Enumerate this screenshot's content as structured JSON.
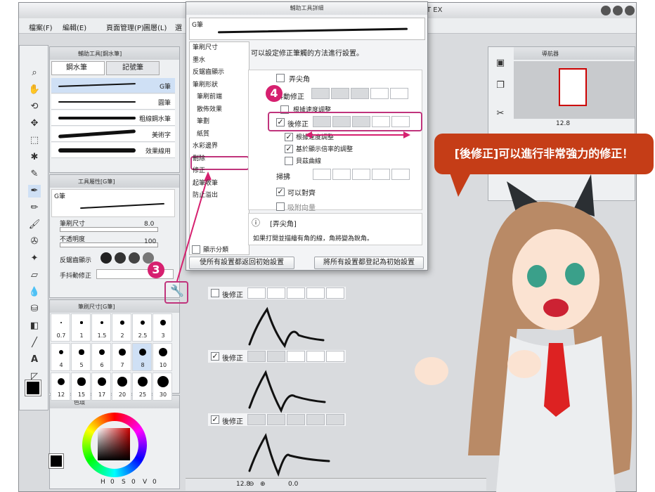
{
  "app": {
    "title_suffix": "T EX",
    "menu": [
      "檔案(F)",
      "編輯(E)",
      "頁面管理(P)",
      "圖層(L)",
      "選"
    ]
  },
  "subtool_panel": {
    "title": "輔助工具[鋼水筆]",
    "tabs": [
      "鋼水筆",
      "記號筆"
    ],
    "items": [
      "G筆",
      "圓筆",
      "粗線鋼水筆",
      "美術字",
      "效果線用"
    ]
  },
  "property_panel": {
    "title": "工具屬性[G筆]",
    "brush_name": "G筆",
    "brush_size_label": "筆刷尺寸",
    "brush_size_value": "8.0",
    "opacity_label": "不透明度",
    "opacity_value": "100",
    "aa_label": "反鋸齒顯示",
    "stabilize_label": "手抖動修正"
  },
  "brushsize_panel": {
    "title": "筆刷尺寸[G筆]",
    "sizes": [
      "0.7",
      "1",
      "1.5",
      "2",
      "2.5",
      "3",
      "4",
      "5",
      "6",
      "7",
      "8",
      "10",
      "12",
      "15",
      "17",
      "20",
      "25",
      "30"
    ]
  },
  "color_panel": {
    "tab": "色環",
    "values": [
      "H",
      "0",
      "S",
      "0",
      "V",
      "0"
    ]
  },
  "navigator": {
    "title": "導航器",
    "zoom": "12.8"
  },
  "dialog": {
    "title": "輔助工具詳細",
    "brush_name": "G筆",
    "categories": [
      "筆刷尺寸",
      "墨水",
      "反鋸齒顯示",
      "筆刷形狀",
      "筆刷前端",
      "散佈效果",
      "筆劃",
      "紙質",
      "水彩邊界",
      "刪除",
      "修正",
      "起筆收筆",
      "防止溢出"
    ],
    "description": "可以設定修正筆觸的方法進行設置。",
    "settings": {
      "sharp": "弄尖角",
      "stabilize": "手抖動修正",
      "speed": "根據速度調整",
      "post": "後修正",
      "by_speed": "根據速度調整",
      "by_zoom": "基於顯示倍率的調整",
      "bezier": "貝茲曲線",
      "thin": "掃拂",
      "align": "可以對齊",
      "vector": "吸附向量"
    },
    "help_title": "[弄尖角]",
    "help_text": "如果打開並描繪有角的線，角將變為銳角。",
    "show_category": "顯示分類",
    "reset_btn": "使所有設置都返回初始設置",
    "register_btn": "將所有設置都登記為初始設置"
  },
  "markers": {
    "step3": "3",
    "step4": "4"
  },
  "bubble_text": "[後修正]可以進行非常強力的修正！",
  "examples": [
    {
      "label": "後修正",
      "checked": false
    },
    {
      "label": "後修正",
      "checked": true
    },
    {
      "label": "後修正",
      "checked": true
    }
  ],
  "canvas_bar": {
    "zoom": "12.8",
    "value": "0.0"
  },
  "colors": {
    "accent": "#d6206f",
    "bubble": "#c53d17",
    "highlight": "#c0347c"
  }
}
